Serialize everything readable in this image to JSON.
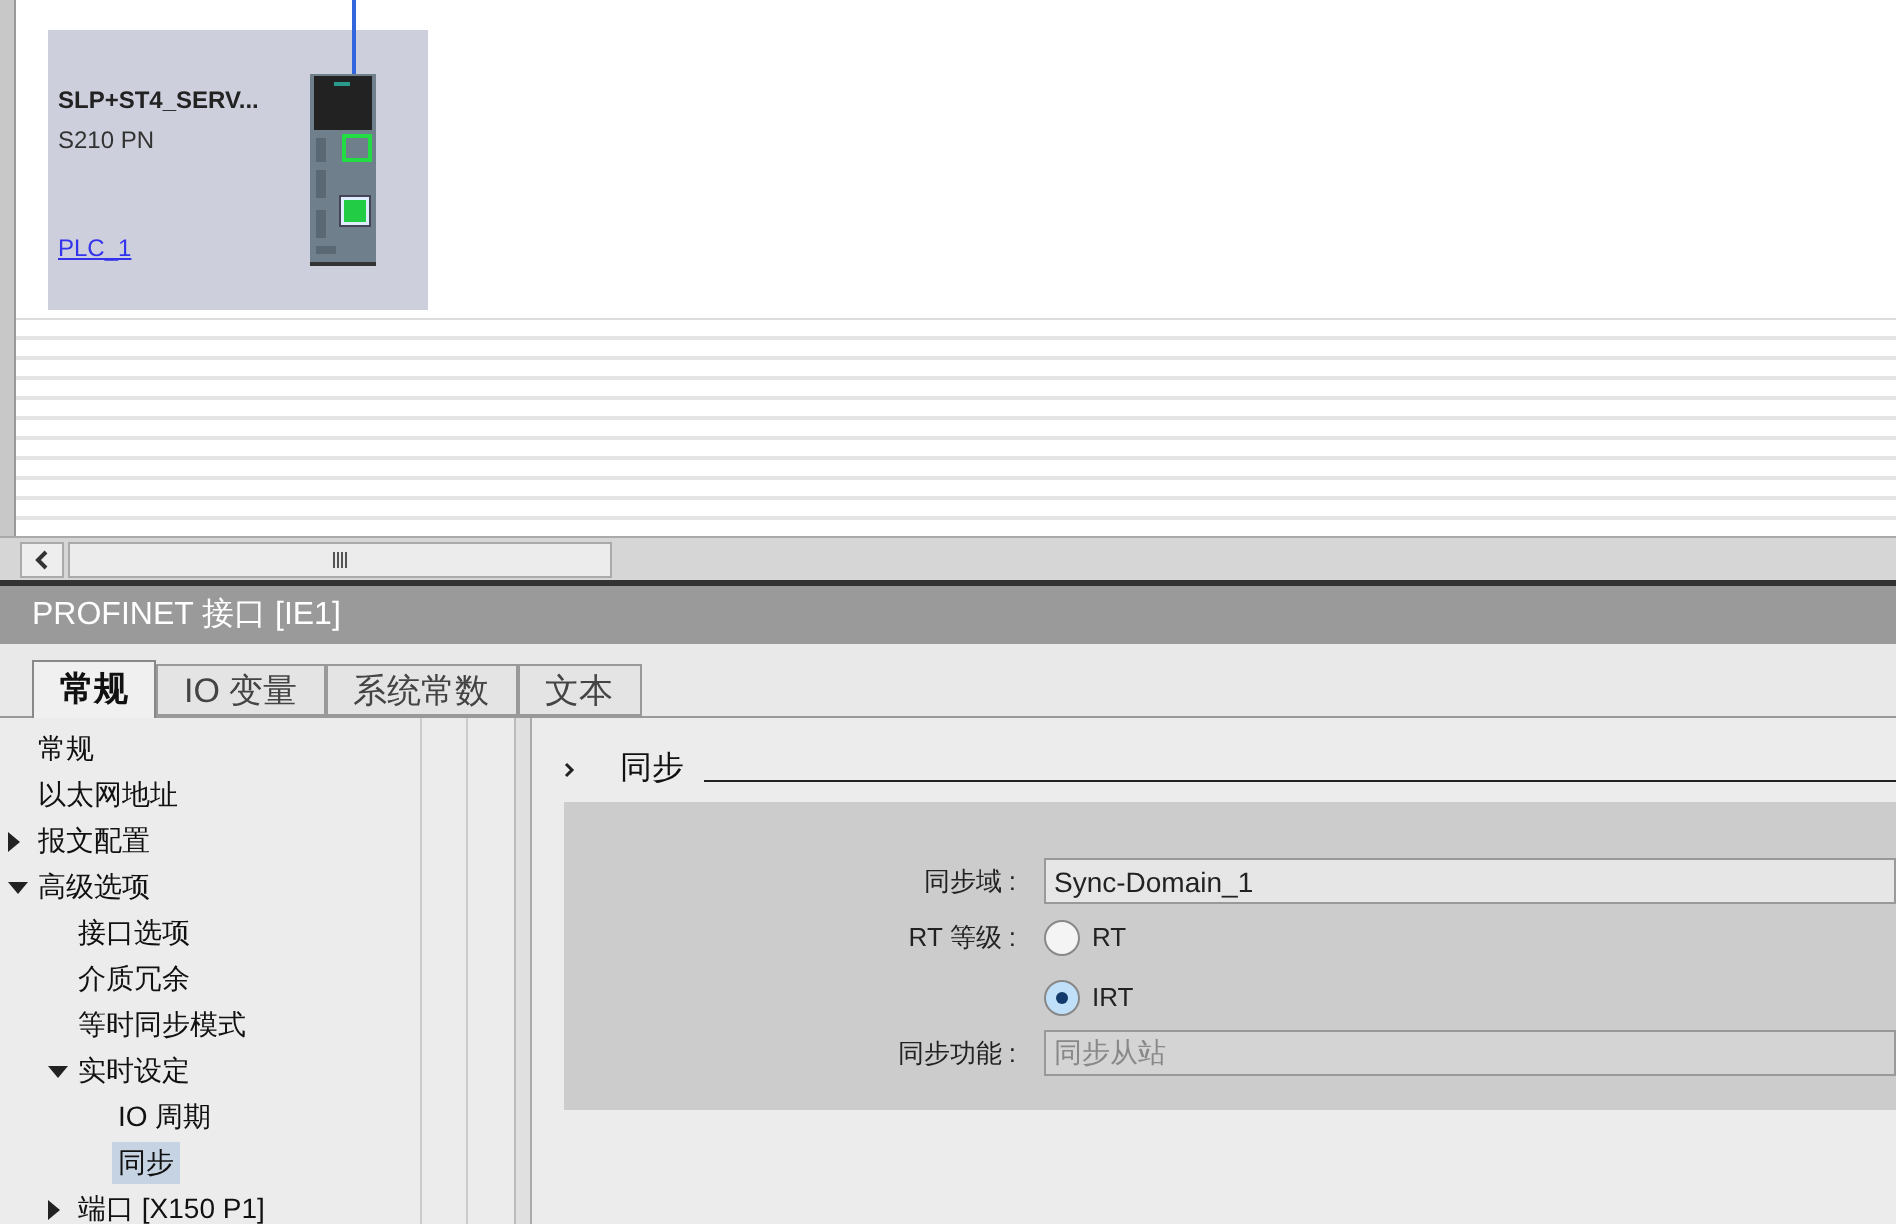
{
  "device": {
    "name": "SLP+ST4_SERV...",
    "type": "S210 PN",
    "link": "PLC_1"
  },
  "inspector": {
    "title": "PROFINET 接口 [IE1]",
    "tabs": [
      {
        "label": "常规",
        "selected": true
      },
      {
        "label": "IO 变量",
        "selected": false
      },
      {
        "label": "系统常数",
        "selected": false
      },
      {
        "label": "文本",
        "selected": false
      }
    ],
    "tree": [
      {
        "label": "常规",
        "selected": false
      },
      {
        "label": "以太网地址",
        "selected": false
      },
      {
        "label": "报文配置",
        "selected": false,
        "expanded": false
      },
      {
        "label": "高级选项",
        "selected": false,
        "expanded": true,
        "children": [
          {
            "label": "接口选项",
            "selected": false
          },
          {
            "label": "介质冗余",
            "selected": false
          },
          {
            "label": "等时同步模式",
            "selected": false
          },
          {
            "label": "实时设定",
            "selected": false,
            "expanded": true,
            "children": [
              {
                "label": "IO 周期",
                "selected": false
              },
              {
                "label": "同步",
                "selected": true
              }
            ]
          },
          {
            "label": "端口 [X150 P1]",
            "selected": false,
            "expanded": false
          }
        ]
      }
    ],
    "section": {
      "title": "同步",
      "fields": [
        {
          "kind": "text",
          "label": "同步域 :",
          "value": "Sync-Domain_1",
          "disabled": false
        },
        {
          "kind": "radio",
          "label": "RT 等级 :",
          "options": [
            {
              "label": "RT",
              "selected": false
            },
            {
              "label": "IRT",
              "selected": true
            }
          ]
        },
        {
          "kind": "text",
          "label": "同步功能 :",
          "value": "同步从站",
          "disabled": true
        }
      ]
    }
  }
}
